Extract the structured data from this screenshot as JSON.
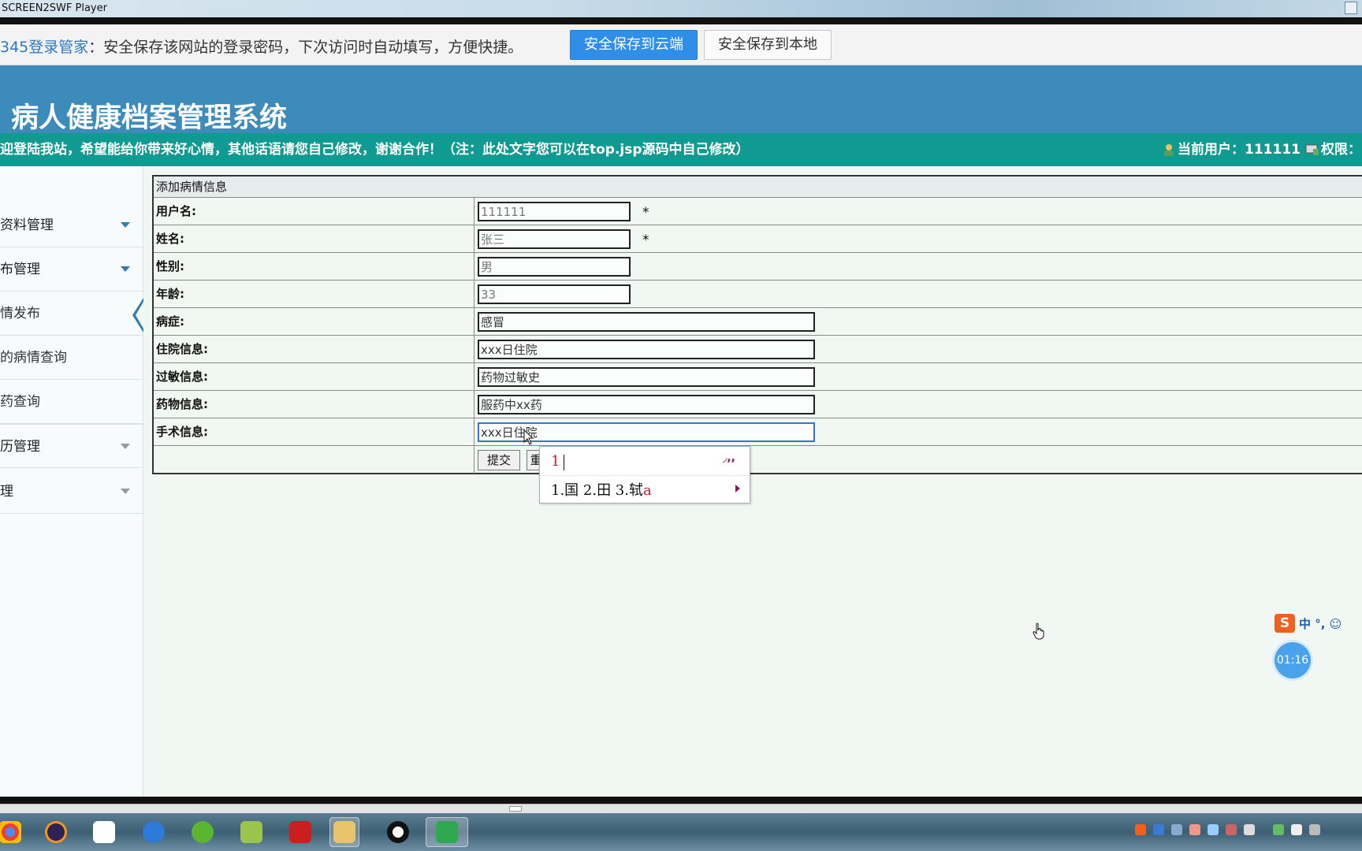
{
  "window": {
    "title": "SCREEN2SWF Player"
  },
  "password_bar": {
    "brand": "345登录管家",
    "message": "：安全保存该网站的登录密码，下次访问时自动填写，方便快捷。",
    "save_cloud": "安全保存到云端",
    "save_local": "安全保存到本地"
  },
  "header": {
    "system_title": "病人健康档案管理系统",
    "welcome_text": "迎登陆我站，希望能给你带来好心情，其他话语请您自己修改，谢谢合作！（注：此处文字您可以在top.jsp源码中自己修改）",
    "current_user_label": "当前用户：111111",
    "permission_label": "权限："
  },
  "sidebar": {
    "items": [
      {
        "label": "资料管理",
        "expanded": true
      },
      {
        "label": "布管理",
        "expanded": true
      },
      {
        "label": "情发布",
        "active": true
      },
      {
        "label": "的病情查询"
      },
      {
        "label": "药查询"
      },
      {
        "label": "历管理",
        "expanded": false
      },
      {
        "label": "理",
        "expanded": false
      }
    ]
  },
  "form": {
    "caption": "添加病情信息",
    "fields": [
      {
        "label": "用户名:",
        "value": "111111",
        "required": "*"
      },
      {
        "label": "姓名:",
        "value": "张三",
        "required": "*"
      },
      {
        "label": "性别:",
        "value": "男"
      },
      {
        "label": "年龄:",
        "value": "33"
      },
      {
        "label": "病症:",
        "value": "感冒"
      },
      {
        "label": "住院信息:",
        "value": "xxx日住院"
      },
      {
        "label": "过敏信息:",
        "value": "药物过敏史"
      },
      {
        "label": "药物信息:",
        "value": "服药中xx药"
      },
      {
        "label": "手术信息:",
        "value": "xxx日住院"
      }
    ],
    "submit_label": "提交",
    "reset_label": "重"
  },
  "ime": {
    "composition": "1",
    "marks": "◞,,",
    "candidates_prefix": "1.国 2.田 3.轼",
    "candidate_highlight": "a"
  },
  "widgets": {
    "sogou_text": "中 °, ☺",
    "sogou_logo": "S",
    "timer": "01:16"
  },
  "colors": {
    "header_blue": "#3d8bba",
    "notice_teal": "#119a92",
    "accent_blue": "#2f8fe8"
  }
}
